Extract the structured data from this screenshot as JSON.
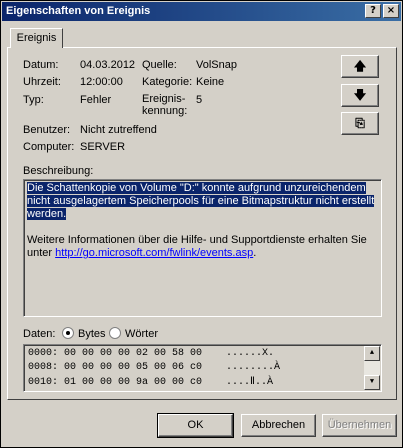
{
  "window": {
    "title": "Eigenschaften von Ereignis",
    "help_glyph": "?",
    "close_glyph": "×"
  },
  "tab": {
    "label": "Ereignis"
  },
  "fields": {
    "date_label": "Datum:",
    "date_value": "04.03.2012",
    "time_label": "Uhrzeit:",
    "time_value": "12:00:00",
    "type_label": "Typ:",
    "type_value": "Fehler",
    "user_label": "Benutzer:",
    "user_value": "Nicht zutreffend",
    "computer_label": "Computer:",
    "computer_value": "SERVER",
    "source_label": "Quelle:",
    "source_value": "VolSnap",
    "category_label": "Kategorie:",
    "category_value": "Keine",
    "eventid_label_1": "Ereignis-",
    "eventid_label_2": "kennung:",
    "eventid_value": "5"
  },
  "nav": {
    "up_glyph": "🡅",
    "down_glyph": "🡇",
    "copy_glyph": "⎘"
  },
  "description": {
    "label": "Beschreibung:",
    "selected_lines": [
      "Die Schattenkopie von Volume \"D:\" konnte aufgrund unzureichendem",
      "nicht ausgelagertem Speicherpools für eine Bitmapstruktur nicht erstellt",
      "werden."
    ],
    "info_line_1": "Weitere Informationen über die Hilfe- und Supportdienste erhalten Sie",
    "info_line_2_prefix": "unter ",
    "info_link": "http://go.microsoft.com/fwlink/events.asp",
    "info_line_2_suffix": "."
  },
  "data": {
    "label": "Daten:",
    "radio_bytes": "Bytes",
    "radio_words": "Wörter",
    "selected": "bytes",
    "rows": [
      "0000: 00 00 00 00 02 00 58 00    ......X.",
      "0008: 00 00 00 00 05 00 06 c0    ........À",
      "0010: 01 00 00 00 9a 00 00 c0    ....Ⅱ..À"
    ]
  },
  "buttons": {
    "ok": "OK",
    "cancel": "Abbrechen",
    "apply": "Übernehmen"
  }
}
